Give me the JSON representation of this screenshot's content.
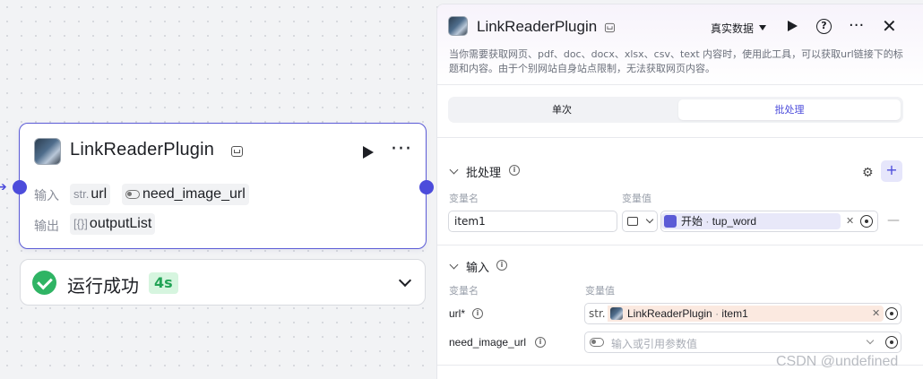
{
  "node": {
    "title": "LinkReaderPlugin",
    "input_label": "输入",
    "output_label": "输出",
    "inputs": [
      {
        "type_prefix": "str.",
        "name": "url"
      },
      {
        "type_prefix": "",
        "name": "need_image_url"
      }
    ],
    "outputs": [
      {
        "type_prefix": "[{}]",
        "name": "outputList"
      }
    ]
  },
  "run_result": {
    "status": "运行成功",
    "duration": "4s"
  },
  "panel": {
    "title": "LinkReaderPlugin",
    "mode": "真实数据",
    "description": "当你需要获取网页、pdf、doc、docx、xlsx、csv、text 内容时，使用此工具，可以获取url链接下的标题和内容。由于个别网站自身站点限制，无法获取网页内容。",
    "tabs": [
      {
        "label": "单次",
        "active": false
      },
      {
        "label": "批处理",
        "active": true
      }
    ],
    "batch": {
      "title": "批处理",
      "col_name": "变量名",
      "col_value": "变量值",
      "row": {
        "name": "item1",
        "ref_source": "开始",
        "ref_separator": " · ",
        "ref_var": "tup_word"
      }
    },
    "input": {
      "title": "输入",
      "col_name": "变量名",
      "col_value": "变量值",
      "rows": [
        {
          "label": "url*",
          "type_prefix": "str.",
          "ref_source": "LinkReaderPlugin",
          "ref_separator": " · ",
          "ref_var": "item1"
        },
        {
          "label": "need_image_url",
          "placeholder": "输入或引用参数值"
        }
      ]
    }
  },
  "watermark": "CSDN @undefined",
  "colors": {
    "accent": "#4c4cdb",
    "success": "#2fb464",
    "success_bg": "#d6f5df"
  }
}
